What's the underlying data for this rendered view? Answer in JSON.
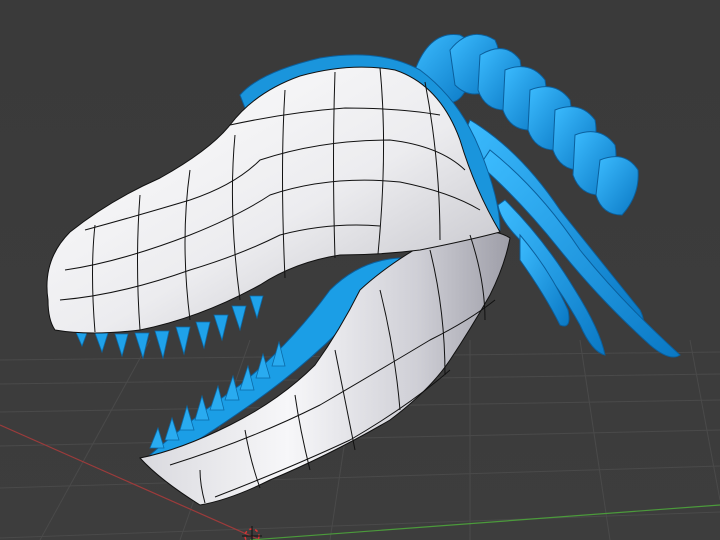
{
  "viewport": {
    "background_color": "#3b3b3b",
    "grid_color": "#4a4a4a",
    "x_axis_color": "#9c3b3b",
    "y_axis_color": "#4b9a3b",
    "surface_color": "#f1f1f4",
    "wire_color": "#111111",
    "skeleton_color": "#1b9ee6",
    "cursor_icon": "3d-cursor-icon"
  }
}
